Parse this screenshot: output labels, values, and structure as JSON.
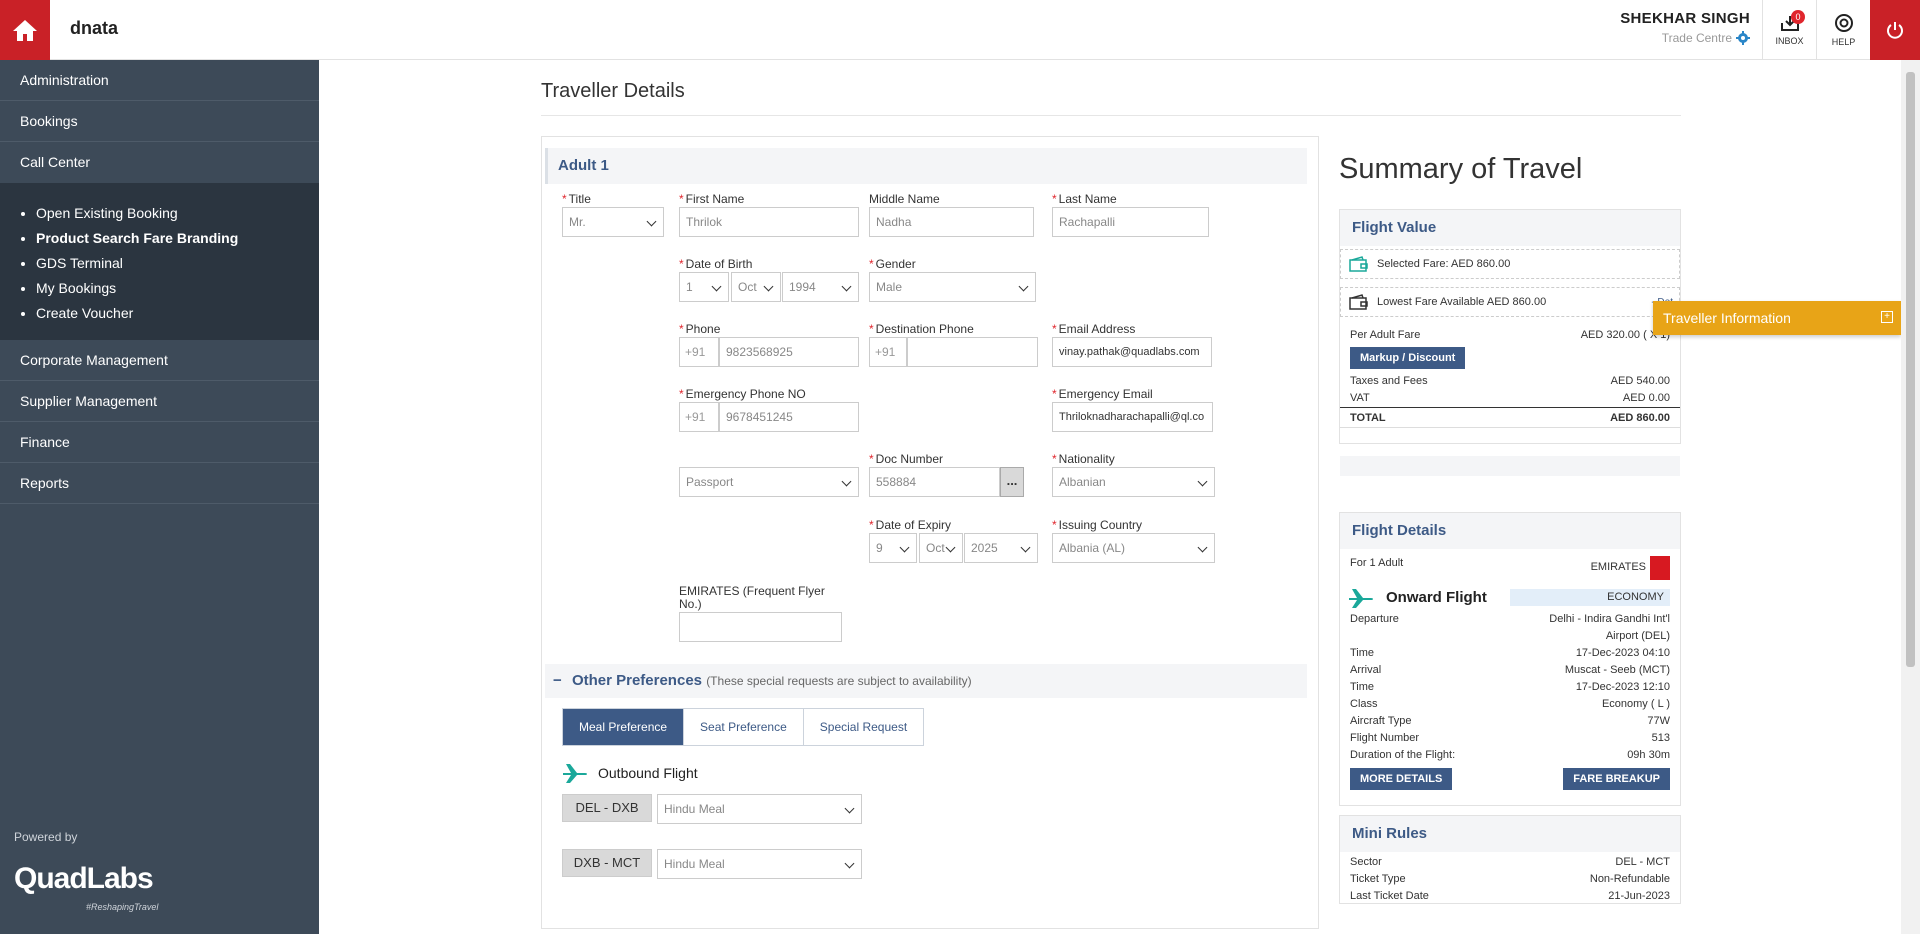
{
  "header": {
    "brand": "dnata",
    "user_name": "SHEKHAR SINGH",
    "user_sub": "Trade Centre",
    "inbox_label": "INBOX",
    "inbox_count": "0",
    "help_label": "HELP"
  },
  "sidebar": {
    "items_top": [
      "Administration",
      "Bookings",
      "Call Center"
    ],
    "sub_items": [
      "Open Existing Booking",
      "Product Search Fare Branding",
      "GDS Terminal",
      "My Bookings",
      "Create Voucher"
    ],
    "items_bottom": [
      "Corporate Management",
      "Supplier Management",
      "Finance",
      "Reports"
    ],
    "powered_by": "Powered by",
    "logo": "QuadLabs",
    "tagline": "#ReshapingTravel"
  },
  "page": {
    "title": "Traveller Details"
  },
  "adult": {
    "heading": "Adult 1",
    "title_label": "Title",
    "title_value": "Mr.",
    "first_label": "First Name",
    "first_value": "Thrilok",
    "middle_label": "Middle Name",
    "middle_value": "Nadha",
    "last_label": "Last Name",
    "last_value": "Rachapalli",
    "dob_label": "Date of Birth",
    "dob_day": "1",
    "dob_month": "Oct",
    "dob_year": "1994",
    "gender_label": "Gender",
    "gender_value": "Male",
    "phone_label": "Phone",
    "phone_code": "+91",
    "phone_value": "9823568925",
    "dest_phone_label": "Destination Phone",
    "dest_phone_code": "+91",
    "dest_phone_value": "",
    "email_label": "Email Address",
    "email_value": "vinay.pathak@quadlabs.com",
    "emg_phone_label": "Emergency Phone NO",
    "emg_phone_code": "+91",
    "emg_phone_value": "9678451245",
    "emg_email_label": "Emergency Email",
    "emg_email_value": "Thriloknadharachapalli@ql.co",
    "doc_type": "Passport",
    "doc_number_label": "Doc Number",
    "doc_number_value": "558884",
    "doc_more": "...",
    "nationality_label": "Nationality",
    "nationality_value": "Albanian",
    "expiry_label": "Date of Expiry",
    "exp_day": "9",
    "exp_month": "Oct",
    "exp_year": "2025",
    "issuing_label": "Issuing Country",
    "issuing_value": "Albania (AL)",
    "ffn_label_1": "EMIRATES (Frequent Flyer",
    "ffn_label_2": "No.)",
    "ffn_value": ""
  },
  "preferences": {
    "toggle": "−",
    "heading": "Other Preferences",
    "note": "(These special requests are subject to availability)",
    "tabs": [
      "Meal Preference",
      "Seat Preference",
      "Special Request"
    ],
    "outbound_label": "Outbound Flight",
    "segments": [
      {
        "route": "DEL - DXB",
        "meal": "Hindu Meal"
      },
      {
        "route": "DXB - MCT",
        "meal": "Hindu Meal"
      }
    ]
  },
  "summary": {
    "title": "Summary of Travel",
    "flight_value_head": "Flight Value",
    "selected_fare": "Selected Fare: AED 860.00",
    "lowest_fare": "Lowest Fare Available AED 860.00",
    "details_link": "- Det",
    "per_adult_label": "Per Adult Fare",
    "per_adult_value": "AED 320.00 ( X 1)",
    "markup_btn": "Markup / Discount",
    "taxes_label": "Taxes and Fees",
    "taxes_value": "AED 540.00",
    "vat_label": "VAT",
    "vat_value": "AED 0.00",
    "total_label": "TOTAL",
    "total_value": "AED 860.00",
    "flight_details_head": "Flight Details",
    "for_adult": "For 1 Adult",
    "airline": "EMIRATES",
    "onward_label": "Onward Flight",
    "cabin": "ECONOMY",
    "rows": [
      {
        "k": "Departure",
        "v": "Delhi - Indira Gandhi Int'l"
      },
      {
        "k": "",
        "v": "Airport (DEL)"
      },
      {
        "k": "Time",
        "v": "17-Dec-2023 04:10"
      },
      {
        "k": "Arrival",
        "v": "Muscat - Seeb (MCT)"
      },
      {
        "k": "Time",
        "v": "17-Dec-2023 12:10"
      },
      {
        "k": "Class",
        "v": "Economy ( L )"
      },
      {
        "k": "Aircraft Type",
        "v": "77W"
      },
      {
        "k": "Flight Number",
        "v": "513"
      },
      {
        "k": "Duration of the Flight:",
        "v": "09h 30m"
      }
    ],
    "more_details_btn": "MORE DETAILS",
    "fare_breakup_btn": "FARE BREAKUP",
    "mini_rules_head": "Mini Rules",
    "rules": [
      {
        "k": "Sector",
        "v": "DEL - MCT"
      },
      {
        "k": "Ticket Type",
        "v": "Non-Refundable"
      },
      {
        "k": "Last Ticket Date",
        "v": "21-Jun-2023"
      }
    ]
  },
  "traveller_info": {
    "label": "Traveller Information",
    "plus": "+"
  }
}
